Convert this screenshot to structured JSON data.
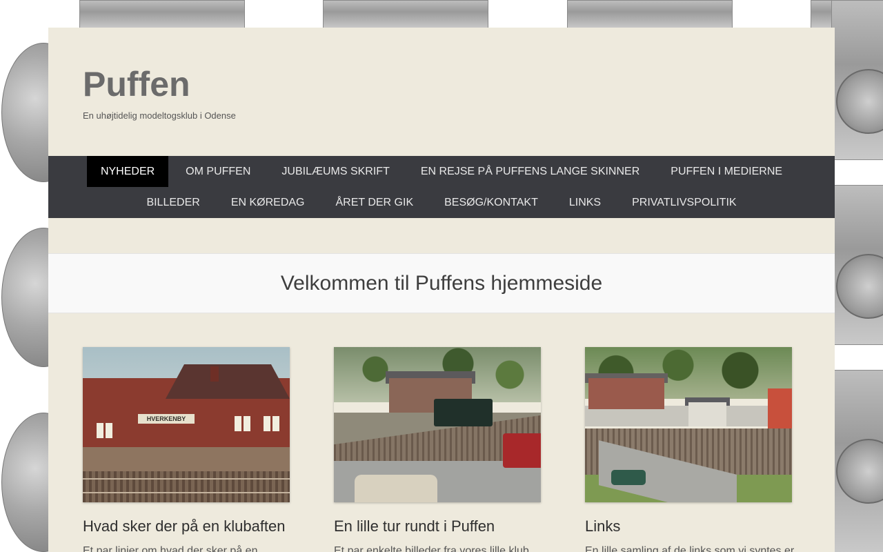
{
  "site": {
    "title": "Puffen",
    "tagline": "En uhøjtidelig modeltogsklub i Odense"
  },
  "nav": {
    "row1": [
      {
        "label": "NYHEDER",
        "active": true
      },
      {
        "label": "OM PUFFEN",
        "active": false
      },
      {
        "label": "JUBILÆUMS SKRIFT",
        "active": false
      },
      {
        "label": "EN REJSE PÅ PUFFENS LANGE SKINNER",
        "active": false
      },
      {
        "label": "PUFFEN I MEDIERNE",
        "active": false
      }
    ],
    "row2": [
      {
        "label": "BILLEDER",
        "active": false
      },
      {
        "label": "EN KØREDAG",
        "active": false
      },
      {
        "label": "ÅRET DER GIK",
        "active": false
      },
      {
        "label": "BESØG/KONTAKT",
        "active": false
      },
      {
        "label": "LINKS",
        "active": false
      },
      {
        "label": "PRIVATLIVSPOLITIK",
        "active": false
      }
    ]
  },
  "welcome": {
    "title": "Velkommen til Puffens hjemmeside"
  },
  "cards": [
    {
      "title": "Hvad sker der på en klubaften",
      "excerpt": "Et par linier om hvad der sker på en",
      "image_sign": "HVERKENBY"
    },
    {
      "title": "En lille tur rundt i Puffen",
      "excerpt": "Et par enkelte billeder fra vores lille klub"
    },
    {
      "title": "Links",
      "excerpt": "En lille samling af de links som vi syntes er"
    }
  ],
  "colors": {
    "page_bg": "#eeeadd",
    "nav_bg": "#3a3b40",
    "nav_active_bg": "#000000",
    "welcome_bg": "#f9f9f9",
    "title_color": "#6b6b6b"
  }
}
